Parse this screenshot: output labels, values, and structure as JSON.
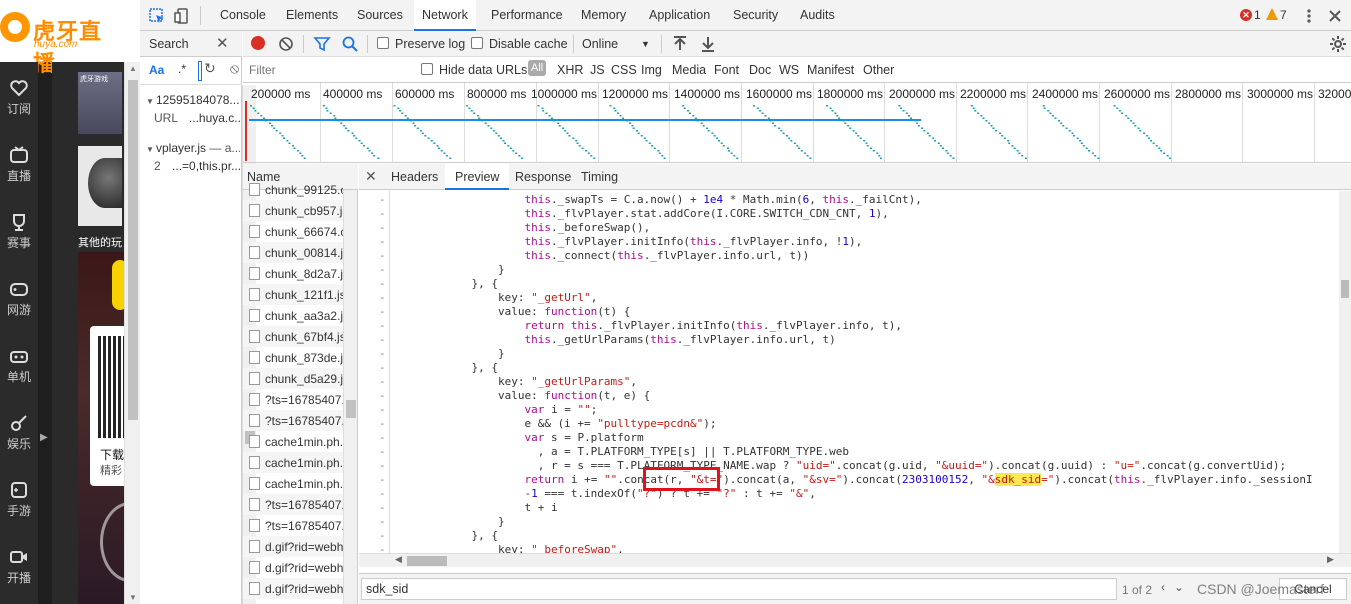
{
  "site": {
    "logo_name": "虎牙直播",
    "logo_sub": "huya.com",
    "nav": [
      {
        "label": "订阅",
        "icon": "heart-icon"
      },
      {
        "label": "直播",
        "icon": "tv-icon"
      },
      {
        "label": "赛事",
        "icon": "trophy-icon"
      },
      {
        "label": "网游",
        "icon": "gamepad-icon"
      },
      {
        "label": "单机",
        "icon": "joystick-icon"
      },
      {
        "label": "娱乐",
        "icon": "guitar-icon"
      },
      {
        "label": "手游",
        "icon": "phone-game-icon"
      },
      {
        "label": "开播",
        "icon": "camera-icon"
      }
    ],
    "thumb_label": "虎牙游戏",
    "other_text": "其他的玩",
    "download_label": "下载",
    "download_sub": "精彩"
  },
  "devtools": {
    "tabs": [
      "Console",
      "Elements",
      "Sources",
      "Network",
      "Performance",
      "Memory",
      "Application",
      "Security",
      "Audits"
    ],
    "active_tab": "Network",
    "errors": "1",
    "warnings": "7",
    "search_panel": {
      "title": "Search",
      "case_label": "Aa",
      "regex_label": ".*",
      "results": [
        {
          "file": "12595184078...",
          "key": "URL",
          "value": "...huya.c..."
        },
        {
          "file": "vplayer.js",
          "suffix": "— a...",
          "line": "2",
          "value": "...=0,this.pr..."
        }
      ]
    },
    "toolbar": {
      "preserve_log": "Preserve log",
      "disable_cache": "Disable cache",
      "throttle": "Online"
    },
    "filter": {
      "placeholder": "Filter",
      "hide_data_urls": "Hide data URLs",
      "types": [
        "All",
        "XHR",
        "JS",
        "CSS",
        "Img",
        "Media",
        "Font",
        "Doc",
        "WS",
        "Manifest",
        "Other"
      ]
    },
    "overview_ticks": [
      "200000 ms",
      "400000 ms",
      "600000 ms",
      "800000 ms",
      "1000000 ms",
      "1200000 ms",
      "1400000 ms",
      "1600000 ms",
      "1800000 ms",
      "2000000 ms",
      "2200000 ms",
      "2400000 ms",
      "2600000 ms",
      "2800000 ms",
      "3000000 ms",
      "32000"
    ],
    "requests": {
      "header": "Name",
      "items": [
        "chunk_99125.c",
        "chunk_cb957.js",
        "chunk_66674.c",
        "chunk_00814.js",
        "chunk_8d2a7.j",
        "chunk_121f1.js",
        "chunk_aa3a2.js",
        "chunk_67bf4.js",
        "chunk_873de.j",
        "chunk_d5a29.j",
        "?ts=16785407.",
        "?ts=16785407.",
        "cache1min.ph.",
        "cache1min.ph.",
        "cache1min.ph.",
        "?ts=16785407.",
        "?ts=16785407.",
        "d.gif?rid=webh",
        "d.gif?rid=webh",
        "d.gif?rid=webh"
      ]
    },
    "detail_tabs": [
      "Headers",
      "Preview",
      "Response",
      "Timing"
    ],
    "active_detail_tab": "Preview",
    "code": [
      "                    this._swapTs = C.a.now() + 1e4 * Math.min(6, this._failCnt),",
      "                    this._flvPlayer.stat.addCore(I.CORE.SWITCH_CDN_CNT, 1),",
      "                    this._beforeSwap(),",
      "                    this._flvPlayer.initInfo(this._flvPlayer.info, !1),",
      "                    this._connect(this._flvPlayer.info.url, t))",
      "                }",
      "            }, {",
      "                key: \"_getUrl\",",
      "                value: function(t) {",
      "                    return this._flvPlayer.initInfo(this._flvPlayer.info, t),",
      "                    this._getUrlParams(this._flvPlayer.info.url, t)",
      "                }",
      "            }, {",
      "                key: \"_getUrlParams\",",
      "                value: function(t, e) {",
      "                    var i = \"\";",
      "                    e && (i += \"pulltype=pcdn&\");",
      "                    var s = P.platform",
      "                      , a = T.PLATFORM_TYPE[s] || T.PLATFORM_TYPE.web",
      "                      , r = s === T.PLATFORM_TYPE_NAME.wap ? \"uid=\".concat(g.uid, \"&uuid=\").concat(g.uuid) : \"u=\".concat(g.convertUid);",
      "                    return i += \"\".concat(r, \"&t=\").concat(a, \"&sv=\").concat(2303100152, \"&sdk_sid=\").concat(this._flvPlayer.info._sessionI",
      "                    -1 === t.indexOf(\"?\") ? t += \"?\" : t += \"&\",",
      "                    t + i",
      "                }",
      "            }, {",
      "                key: \"_beforeSwap\","
    ],
    "find": {
      "query": "sdk_sid",
      "count": "1 of 2",
      "cancel": "Cancel"
    },
    "watermark": "CSDN @Joemasterf"
  }
}
